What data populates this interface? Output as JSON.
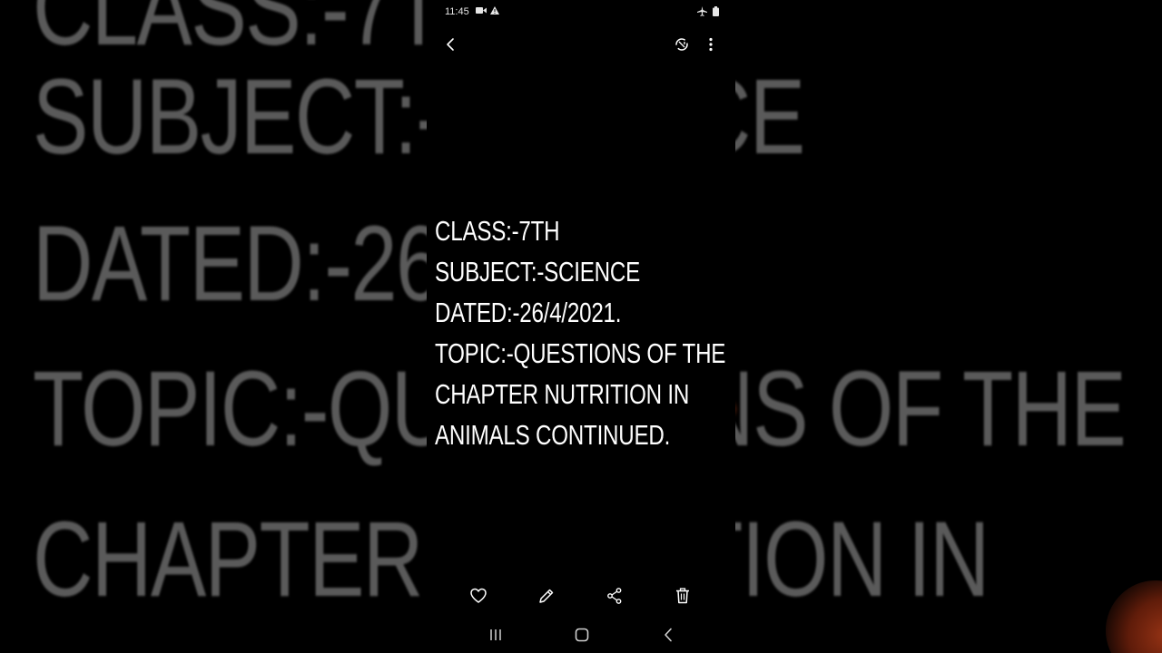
{
  "background": {
    "lines": [
      "CLASS:-7TH",
      "SUBJECT:-SCIENCE",
      "DATED:-26/4/2021.",
      "TOPIC:-QUESTIONS OF THE",
      "CHAPTER NUTRITION IN"
    ]
  },
  "status_bar": {
    "time": "11:45",
    "icons_left": [
      "video-record-icon",
      "warning-icon"
    ],
    "icons_right": [
      "airplane-mode-icon",
      "battery-icon"
    ]
  },
  "top_bar": {
    "icons": [
      "back-icon",
      "auto-rotate-icon",
      "more-options-icon"
    ]
  },
  "image_text": {
    "lines": [
      "CLASS:-7TH",
      "SUBJECT:-SCIENCE",
      "DATED:-26/4/2021.",
      "TOPIC:-QUESTIONS OF THE",
      "CHAPTER NUTRITION IN",
      "ANIMALS CONTINUED."
    ]
  },
  "action_bar": {
    "icons": [
      "favorite-heart-icon",
      "edit-pencil-icon",
      "share-icon",
      "delete-trash-icon"
    ]
  },
  "nav_bar": {
    "icons": [
      "recent-apps-icon",
      "home-icon",
      "nav-back-icon"
    ]
  },
  "colors": {
    "background": "#000000",
    "text": "#ffffff",
    "blurred_text": "#5a5a5a",
    "accent_orb": "#c6461c"
  }
}
